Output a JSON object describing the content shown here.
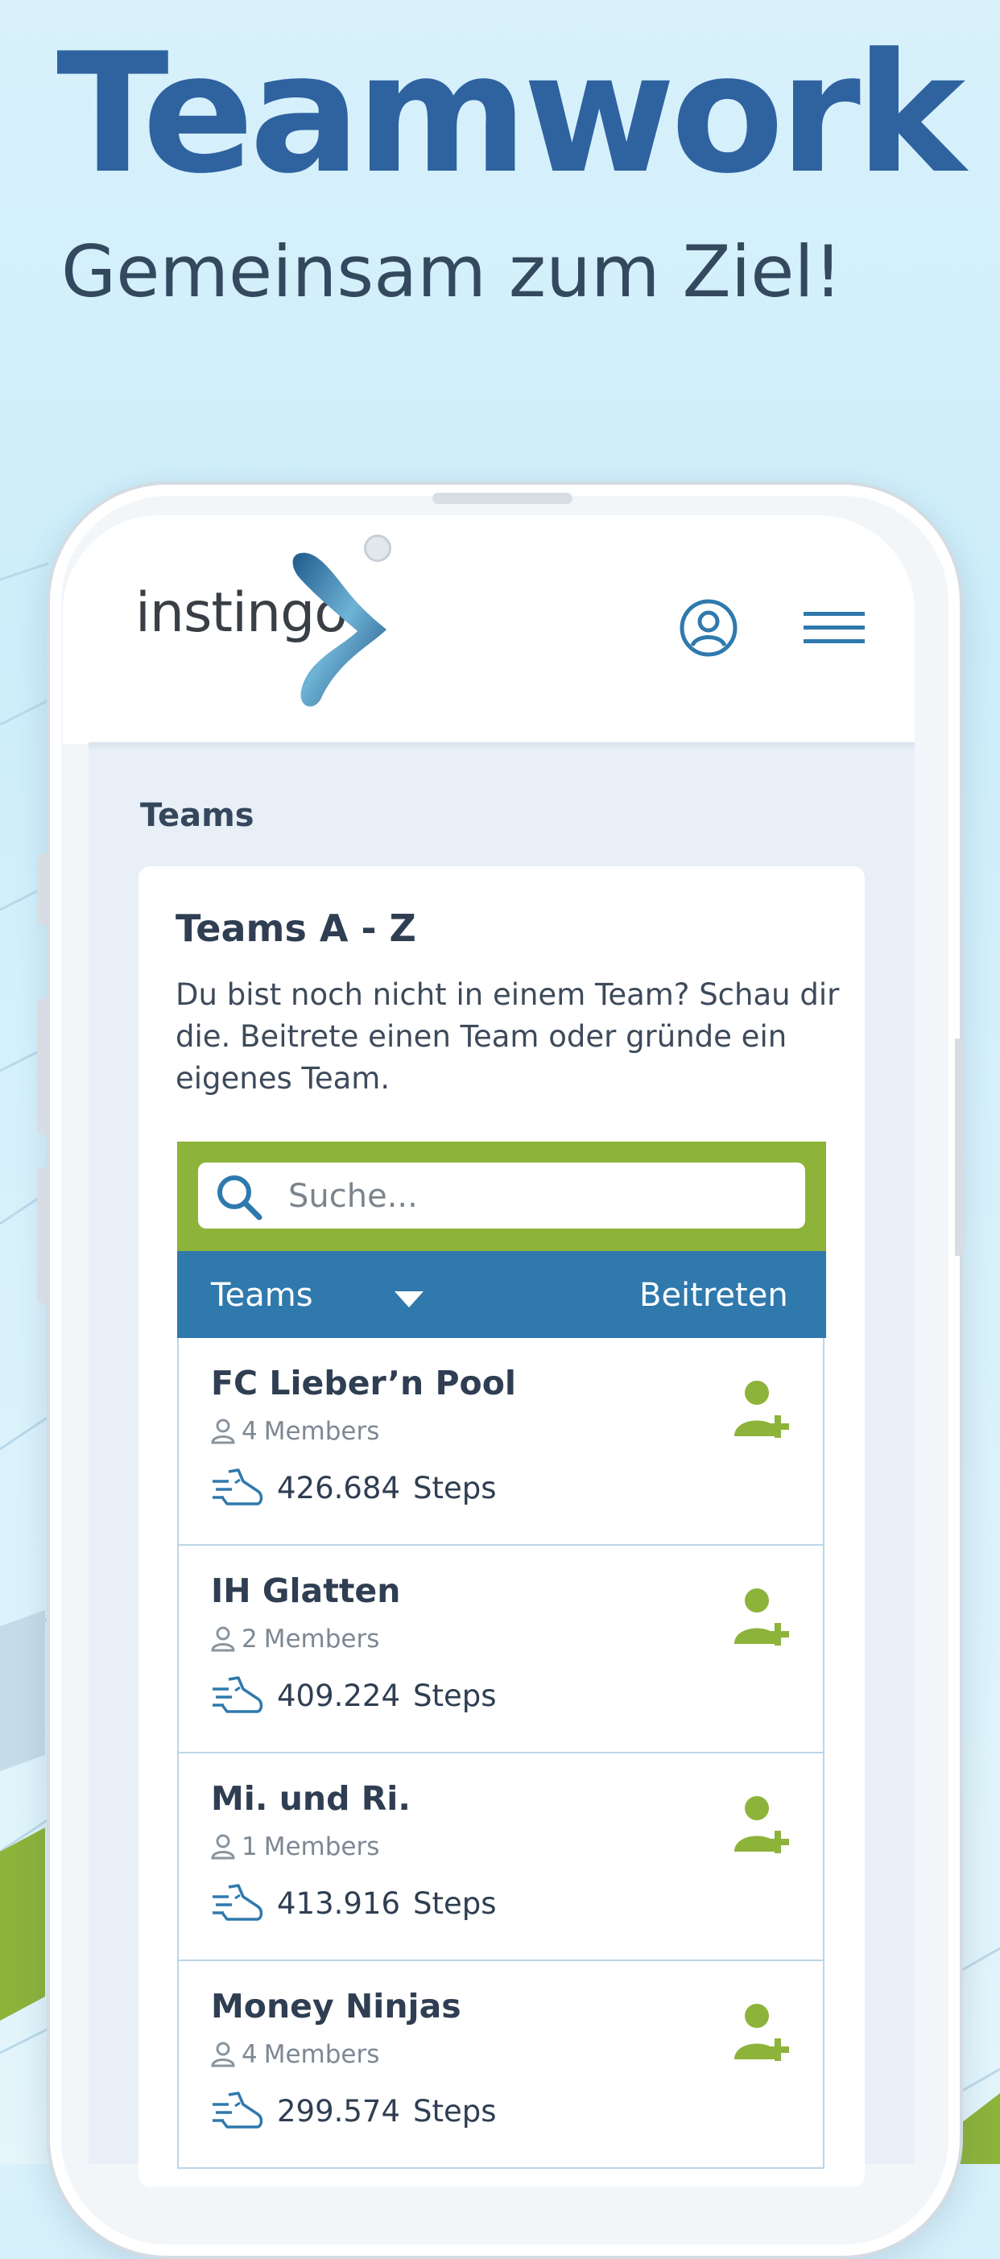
{
  "headline": "Teamwork",
  "subheadline": "Gemeinsam zum Ziel!",
  "header": {
    "logo_text": "instingo",
    "account_icon": "account-circle-icon",
    "menu_icon": "hamburger-menu-icon"
  },
  "page": {
    "section_title": "Teams"
  },
  "card": {
    "title": "Teams A - Z",
    "description": "Du bist noch nicht in einem Team? Schau dir die. Beitrete einen Team oder gründe ein eigenes Team."
  },
  "search": {
    "placeholder": "Suche..."
  },
  "table": {
    "col_teams": "Teams",
    "col_join": "Beitreten",
    "members_label": "Members",
    "steps_label": "Steps",
    "rows": [
      {
        "name": "FC Lieber’n Pool",
        "members": "4",
        "steps": "426.684"
      },
      {
        "name": "IH Glatten",
        "members": "2",
        "steps": "409.224"
      },
      {
        "name": "Mi. und Ri.",
        "members": "1",
        "steps": "413.916"
      },
      {
        "name": "Money Ninjas",
        "members": "4",
        "steps": "299.574"
      }
    ]
  },
  "colors": {
    "headline": "#2f63a0",
    "accent_green": "#8db33a",
    "table_header_blue": "#2f79ad",
    "content_bg": "#e8eff7"
  }
}
